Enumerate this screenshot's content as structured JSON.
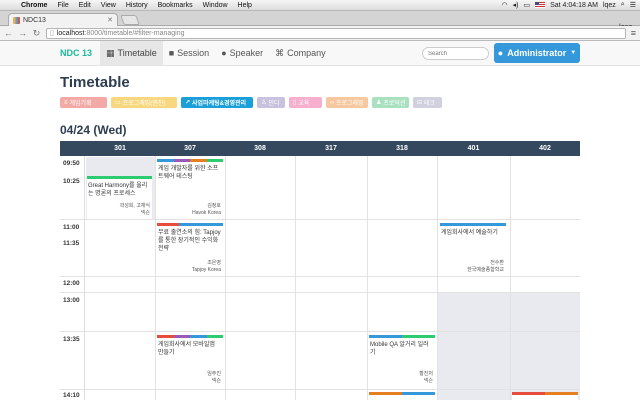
{
  "menubar": {
    "app": "Chrome",
    "items": [
      "File",
      "Edit",
      "View",
      "History",
      "Bookmarks",
      "Window",
      "Help"
    ],
    "clock": "Sat 4:04:18 AM",
    "user": "lqez"
  },
  "browser": {
    "tab_title": "NDC13",
    "url_host": "localhost",
    "url_path": ":8000/timetable/#filter-managing",
    "window_user": "lqez"
  },
  "nav": {
    "brand": "NDC 13",
    "links": [
      {
        "label": "Timetable",
        "icon": "calendar-icon",
        "active": true
      },
      {
        "label": "Session",
        "icon": "video-camera-icon"
      },
      {
        "label": "Speaker",
        "icon": "user-icon"
      },
      {
        "label": "Company",
        "icon": "command-icon"
      }
    ],
    "search_placeholder": "Search",
    "admin_label": "Administrator"
  },
  "page_title": "Timetable",
  "filters": [
    {
      "label": "게임기획",
      "color": "#f3aaa6"
    },
    {
      "label": "프로그래밍(엔진)",
      "color": "#f8d77f"
    },
    {
      "label": "사업마케팅&경영관리",
      "color": "#1a9fd9"
    },
    {
      "label": "인디",
      "color": "#c9c2de"
    },
    {
      "label": "교육",
      "color": "#f6b0cd"
    },
    {
      "label": "프로그래밍",
      "color": "#f7c8a0"
    },
    {
      "label": "프로덕션",
      "color": "#a9e0c0"
    },
    {
      "label": "테크",
      "color": "#d0d0de"
    }
  ],
  "date_heading": "04/24 (Wed)",
  "rooms": [
    "301",
    "307",
    "308",
    "317",
    "318",
    "401",
    "402"
  ],
  "times": [
    "09:50",
    "10:25",
    "11:00",
    "11:35",
    "12:00",
    "13:00",
    "13:35",
    "14:10"
  ],
  "sessions": [
    {
      "title": "Great Harmony를 울리는 명론의 프로세스",
      "speaker": "곽성희, 고재식",
      "company": "넥슨"
    },
    {
      "title": "게임 개발자를 위한 소프트웨어 테스팅",
      "speaker": "김정호",
      "company": "Havok Korea"
    },
    {
      "title": "무료 출연소의 힘: Tapjoy를 통한 장기적인 수익화 전략",
      "speaker": "조은영",
      "company": "Tapjoy Korea"
    },
    {
      "title": "게임회사에서 예술하기",
      "speaker": "전수환",
      "company": "한국예술종합학교"
    },
    {
      "title": "게임회사에서 모바일앱 만들기",
      "speaker": "임주진",
      "company": "넥슨"
    },
    {
      "title": "Mobile QA 알거리 일러기",
      "speaker": "황진저",
      "company": "넥슨"
    }
  ]
}
